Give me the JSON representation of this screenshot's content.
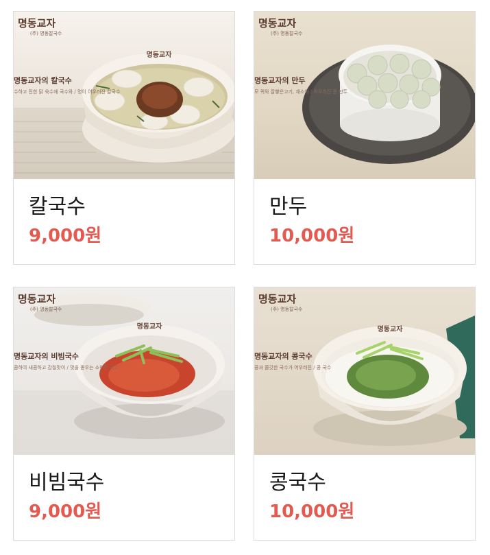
{
  "menu": [
    {
      "name": "칼국수",
      "price": "9,000원",
      "photo_logo": "명동교자",
      "photo_logo_small": "(주) 명동칼국수",
      "photo_caption": "명동교자의 칼국수",
      "photo_caption_sub": "수하고 진한 닭 육수에 국수와 / 명이 어우러진 칼국수",
      "bowl_text": "명동교자"
    },
    {
      "name": "만두",
      "price": "10,000원",
      "photo_logo": "명동교자",
      "photo_logo_small": "(주) 명동칼국수",
      "photo_caption": "명동교자의 만두",
      "photo_caption_sub": "모 퀴와 잘빻은고기, 채소와 / 어우러진 찐 만두",
      "bowl_text": ""
    },
    {
      "name": "비빔국수",
      "price": "9,000원",
      "photo_logo": "명동교자",
      "photo_logo_small": "(주) 명동칼국수",
      "photo_caption": "명동교자의 비빔국수",
      "photo_caption_sub": "콤하여 새콤하고 감칠맛이 / 맛을 돋우는 소박한 국수",
      "bowl_text": "명동교자"
    },
    {
      "name": "콩국수",
      "price": "10,000원",
      "photo_logo": "명동교자",
      "photo_logo_small": "(주) 명동칼국수",
      "photo_caption": "명동교자의 콩국수",
      "photo_caption_sub": "콩과 쫄깃한 국수가 어우러진 / 콩 국수",
      "bowl_text": "명동교자"
    }
  ],
  "colors": {
    "price": "#e25a50",
    "name": "#1a1a1a",
    "border": "#dcdcdc"
  }
}
